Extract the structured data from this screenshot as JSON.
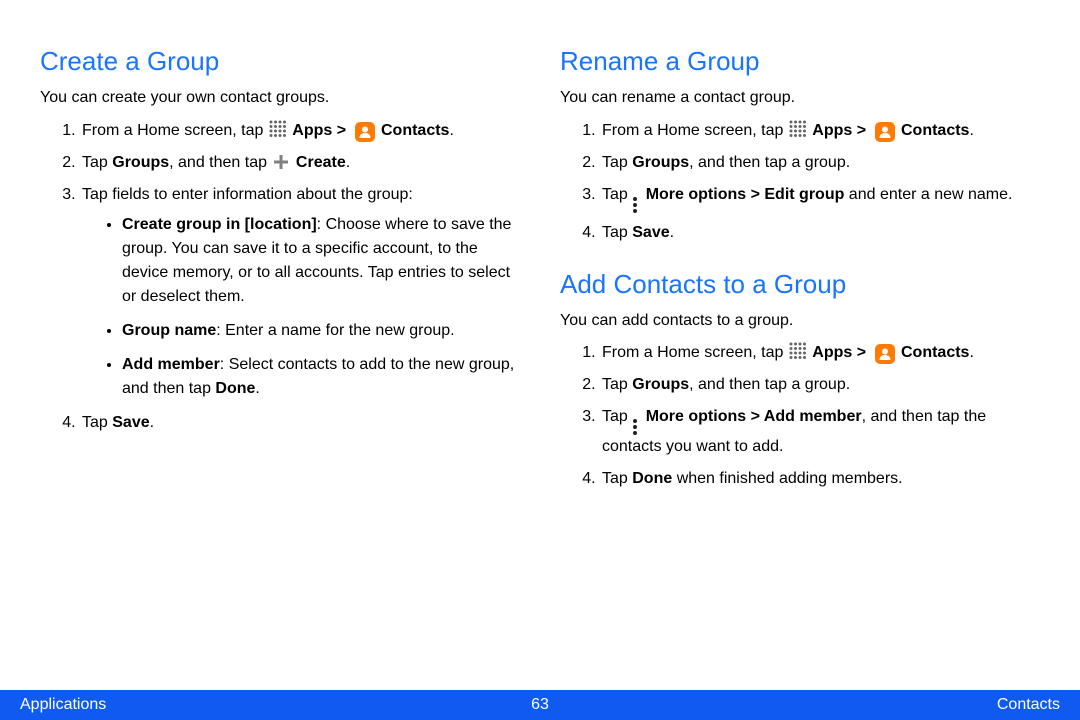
{
  "sections": {
    "create": {
      "title": "Create a Group",
      "intro": "You can create your own contact groups.",
      "steps": {
        "s1_pre": "From a Home screen, tap ",
        "apps_label": "Apps",
        "sep1": " > ",
        "contacts_label": "Contacts",
        "s1_post": ".",
        "s2_pre": "Tap ",
        "s2_groups": "Groups",
        "s2_mid": ", and then tap ",
        "s2_create": "Create",
        "s2_post": ".",
        "s3": "Tap fields to enter information about the group:",
        "b1_label": "Create group in [location]",
        "b1_text": ": Choose where to save the group. You can save it to a specific account, to the device memory, or to all accounts. Tap entries to select or deselect them.",
        "b2_label": "Group name",
        "b2_text": ": Enter a name for the new group.",
        "b3_label": "Add member",
        "b3_text_pre": ": Select contacts to add to the new group, and then tap ",
        "b3_done": "Done",
        "b3_text_post": ".",
        "s4_pre": "Tap ",
        "s4_save": "Save",
        "s4_post": "."
      }
    },
    "rename": {
      "title": "Rename a Group",
      "intro": "You can rename a contact group.",
      "steps": {
        "s1_pre": "From a Home screen, tap ",
        "apps_label": "Apps",
        "sep1": " > ",
        "contacts_label": "Contacts",
        "s1_post": ".",
        "s2_pre": "Tap ",
        "s2_groups": "Groups",
        "s2_post": ", and then tap a group.",
        "s3_pre": "Tap ",
        "s3_more": "More options",
        "s3_sep": " > ",
        "s3_edit": "Edit group",
        "s3_post": " and enter a new name.",
        "s4_pre": "Tap ",
        "s4_save": "Save",
        "s4_post": "."
      }
    },
    "add": {
      "title": "Add Contacts to a Group",
      "intro": "You can add contacts to a group.",
      "steps": {
        "s1_pre": "From a Home screen, tap ",
        "apps_label": "Apps",
        "sep1": " > ",
        "contacts_label": "Contacts",
        "s1_post": ".",
        "s2_pre": "Tap ",
        "s2_groups": "Groups",
        "s2_post": ", and then tap a group.",
        "s3_pre": "Tap ",
        "s3_more": "More options",
        "s3_sep": " > ",
        "s3_addm": "Add member",
        "s3_post": ", and then tap the contacts you want to add.",
        "s4_pre": "Tap ",
        "s4_done": "Done",
        "s4_post": " when finished adding members."
      }
    }
  },
  "footer": {
    "left": "Applications",
    "center": "63",
    "right": "Contacts"
  }
}
